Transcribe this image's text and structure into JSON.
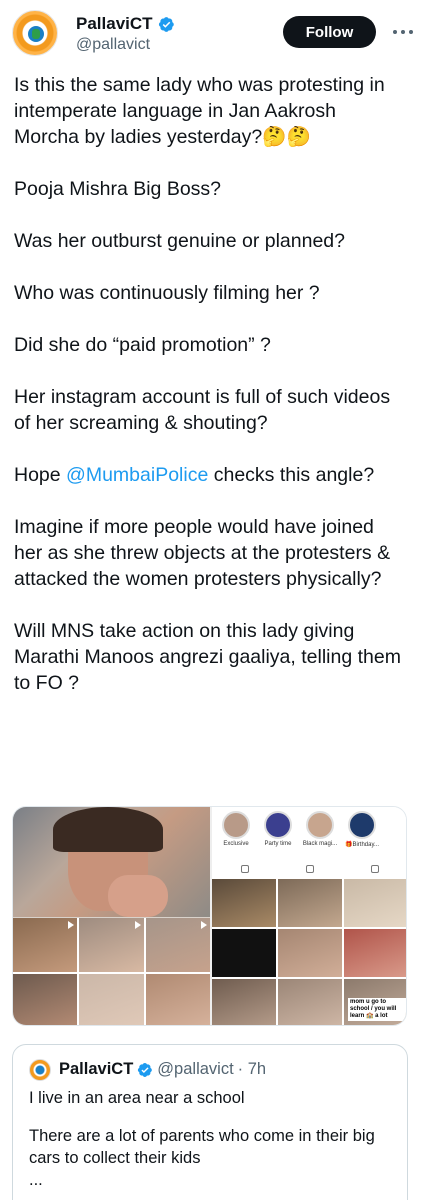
{
  "tweet": {
    "author_name": "PallaviCT",
    "author_handle": "@pallavict",
    "follow_label": "Follow",
    "paragraphs": [
      "Is this the same lady who was protesting in intemperate language in Jan Aakrosh Morcha by ladies yesterday?🤔🤔",
      "Pooja Mishra Big Boss?",
      "Was her outburst genuine or planned?",
      "Who was continuously filming her ?",
      "Did she do “paid promotion” ?",
      "Her instagram account is full of such videos of her screaming & shouting?"
    ],
    "mention_para": {
      "prefix": "Hope ",
      "mention": "@MumbaiPolice",
      "suffix": " checks this angle?"
    },
    "paragraphs_after": [
      "Imagine if more people would have joined her as she threw objects at the protesters & attacked the women protesters physically?",
      "Will MNS take action on this lady giving Marathi Manoos angrezi gaaliya, telling them to FO ?"
    ]
  },
  "media": {
    "story_labels": [
      "Exclusive",
      "Party time",
      "Black magi...",
      "🎁Birthday..."
    ],
    "caption_right": "mom u go to school / you will learn 🏫 a lot"
  },
  "quote": {
    "author_name": "PallaviCT",
    "author_handle": "@pallavict",
    "time": "· 7h",
    "lines": [
      "I live in an area near a school",
      "There are a lot of parents who come in their big cars to collect their kids",
      "..."
    ]
  },
  "colors": {
    "accent": "#1d9bf0",
    "text": "#0f1419",
    "secondary": "#536471",
    "button_bg": "#0f1419"
  }
}
